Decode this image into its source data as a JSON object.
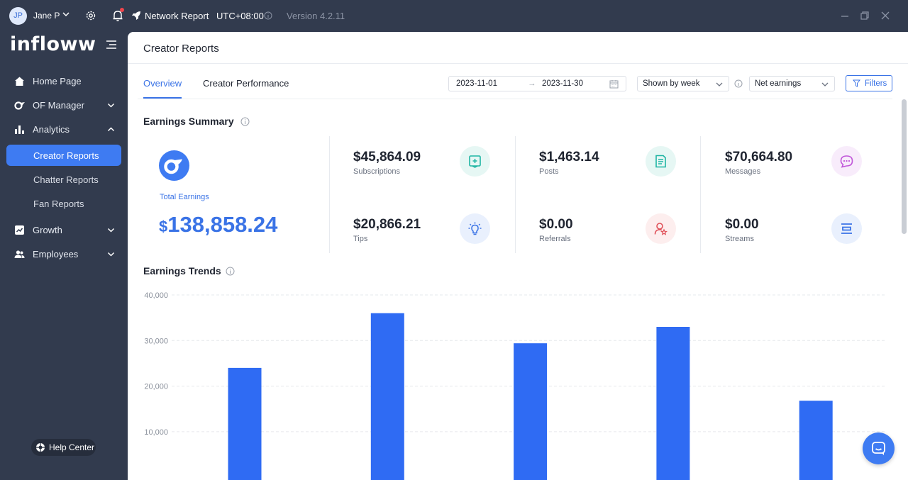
{
  "titlebar": {
    "avatar_initials": "JP",
    "user_name": "Jane P",
    "report_name": "Network Report",
    "timezone": "UTC+08:00",
    "version": "Version 4.2.11"
  },
  "sidebar": {
    "logo": "infloww",
    "items": [
      {
        "label": "Home Page",
        "icon": "home-icon"
      },
      {
        "label": "OF Manager",
        "icon": "of-manager-icon",
        "expandable": true
      },
      {
        "label": "Analytics",
        "icon": "analytics-icon",
        "expanded": true
      },
      {
        "label": "Creator Reports",
        "sub": true,
        "active": true
      },
      {
        "label": "Chatter Reports",
        "sub": true
      },
      {
        "label": "Fan Reports",
        "sub": true
      },
      {
        "label": "Growth",
        "icon": "growth-icon",
        "expandable": true
      },
      {
        "label": "Employees",
        "icon": "employees-icon",
        "expandable": true
      }
    ],
    "help_center": "Help Center"
  },
  "main": {
    "title": "Creator Reports",
    "tabs": [
      {
        "label": "Overview",
        "active": true
      },
      {
        "label": "Creator Performance",
        "active": false
      }
    ],
    "filters": {
      "date_start": "2023-11-01",
      "date_end": "2023-11-30",
      "arrow": "→",
      "grouping": "Shown by week",
      "metric": "Net earnings",
      "filters_label": "Filters"
    },
    "summary": {
      "title": "Earnings Summary",
      "total_label": "Total Earnings",
      "total_currency": "$",
      "total_value": "138,858.24",
      "metrics": [
        {
          "value": "$45,864.09",
          "label": "Subscriptions",
          "icon": "subscriptions-icon",
          "color": "#1fb5a3",
          "bg": "#e6f7f4"
        },
        {
          "value": "$1,463.14",
          "label": "Posts",
          "icon": "posts-icon",
          "color": "#1fb5a3",
          "bg": "#e6f7f4"
        },
        {
          "value": "$70,664.80",
          "label": "Messages",
          "icon": "messages-icon",
          "color": "#c056d9",
          "bg": "#f8ecfb"
        },
        {
          "value": "$20,866.21",
          "label": "Tips",
          "icon": "tips-icon",
          "color": "#3a73e6",
          "bg": "#e9f0fd"
        },
        {
          "value": "$0.00",
          "label": "Referrals",
          "icon": "referrals-icon",
          "color": "#e0525a",
          "bg": "#fdeeee"
        },
        {
          "value": "$0.00",
          "label": "Streams",
          "icon": "streams-icon",
          "color": "#3a73e6",
          "bg": "#e9f0fd"
        }
      ]
    },
    "trends_title": "Earnings Trends"
  },
  "chart_data": {
    "type": "bar",
    "title": "Earnings Trends",
    "xlabel": "",
    "ylabel": "",
    "y_ticks": [
      "40,000",
      "30,000",
      "20,000",
      "10,000"
    ],
    "ylim": [
      0,
      40000
    ],
    "categories": [
      "",
      "",
      "",
      "",
      ""
    ],
    "values": [
      24000,
      36000,
      29400,
      33000,
      16800
    ],
    "grid": true,
    "color": "#2f6bf3"
  }
}
